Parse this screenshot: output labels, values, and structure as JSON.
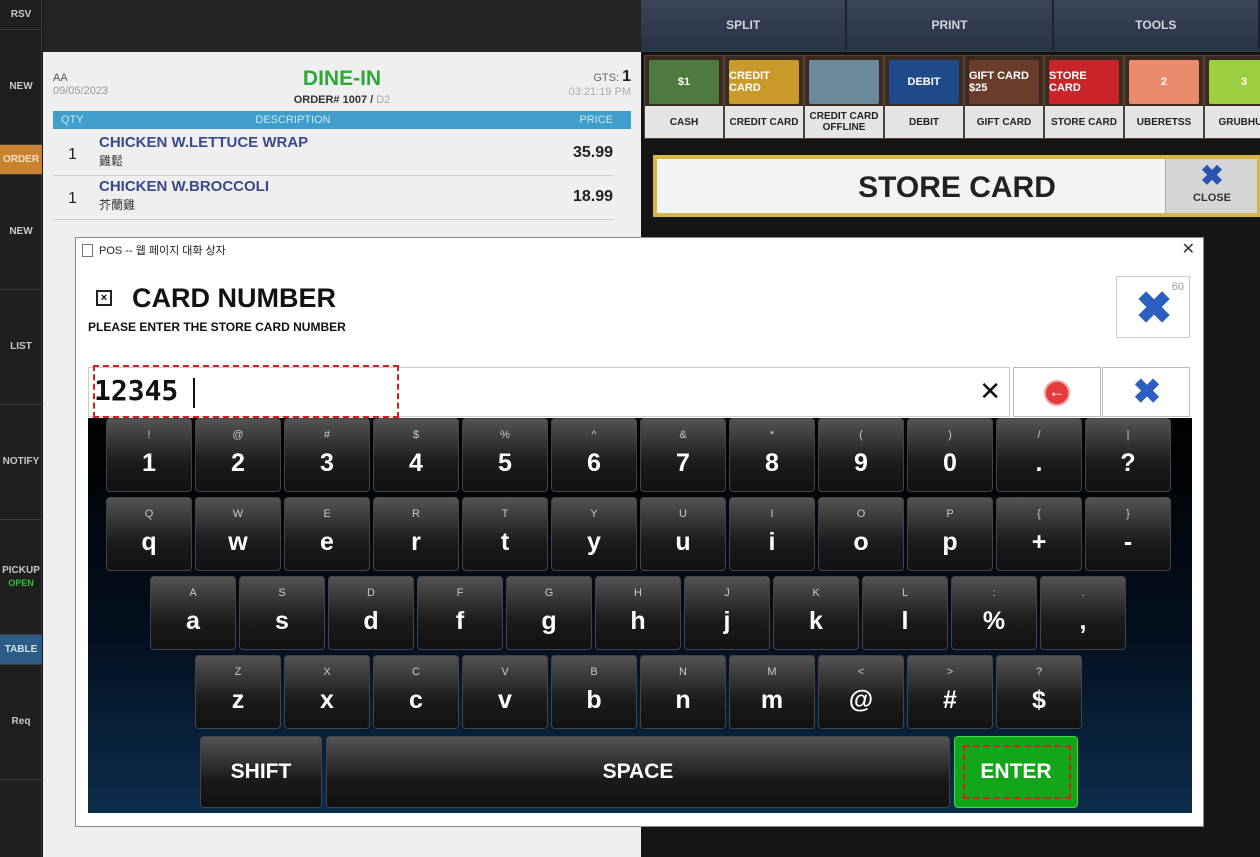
{
  "left_nav": [
    {
      "label": "RSV",
      "sub": ""
    },
    {
      "label": "NEW",
      "sub": ""
    },
    {
      "label": "ORDER",
      "sub": ""
    },
    {
      "label": "NEW",
      "sub": ""
    },
    {
      "label": "LIST",
      "sub": ""
    },
    {
      "label": "NOTIFY",
      "sub": ""
    },
    {
      "label": "PICKUP",
      "sub": "OPEN"
    },
    {
      "label": "TABLE",
      "sub": ""
    },
    {
      "label": "Req",
      "sub": ""
    }
  ],
  "top_buttons": {
    "split": "SPLIT",
    "print": "PRINT",
    "tools": "TOOLS"
  },
  "order": {
    "server": "AA",
    "date": "09/05/2023",
    "title": "DINE-IN",
    "order_label": "ORDER# 1007 /",
    "order_sub": " D2",
    "gts_label": "GTS: ",
    "gts_value": "1",
    "time": "03:21:19 PM",
    "headers": {
      "qty": "QTY",
      "desc": "DESCRIPTION",
      "price": "PRICE"
    },
    "items": [
      {
        "qty": "1",
        "name": "CHICKEN W.LETTUCE WRAP",
        "sub": "雞鬆",
        "price": "35.99"
      },
      {
        "qty": "1",
        "name": "CHICKEN W.BROCCOLI",
        "sub": "芥蘭雞",
        "price": "18.99"
      }
    ]
  },
  "payments": [
    {
      "label": "CASH",
      "img": "$1",
      "color": "#4d7a3f"
    },
    {
      "label": "CREDIT CARD",
      "img": "CREDIT CARD",
      "color": "#c89a2a"
    },
    {
      "label": "CREDIT CARD OFFLINE",
      "img": "",
      "color": "#6b8a9b"
    },
    {
      "label": "DEBIT",
      "img": "DEBIT",
      "color": "#1f4a8a"
    },
    {
      "label": "GIFT CARD",
      "img": "GIFT CARD $25",
      "color": "#6a3c2b"
    },
    {
      "label": "STORE CARD",
      "img": "STORE CARD",
      "color": "#c8242a"
    },
    {
      "label": "UBERETSS",
      "img": "2",
      "color": "#e98b6c"
    },
    {
      "label": "GRUBHUB",
      "img": "3",
      "color": "#9bcf3f"
    }
  ],
  "store_card": {
    "title": "STORE CARD",
    "close": "CLOSE"
  },
  "dialog": {
    "titlebar": "POS -- 웹 페이지 대화 상자",
    "title": "CARD NUMBER",
    "subtitle": "PLEASE ENTER THE STORE CARD NUMBER",
    "timer": "60",
    "input_value": "12345"
  },
  "keyboard": {
    "row1": [
      {
        "s": "!",
        "m": "1"
      },
      {
        "s": "@",
        "m": "2"
      },
      {
        "s": "#",
        "m": "3"
      },
      {
        "s": "$",
        "m": "4"
      },
      {
        "s": "%",
        "m": "5"
      },
      {
        "s": "^",
        "m": "6"
      },
      {
        "s": "&",
        "m": "7"
      },
      {
        "s": "*",
        "m": "8"
      },
      {
        "s": "(",
        "m": "9"
      },
      {
        "s": ")",
        "m": "0"
      },
      {
        "s": "/",
        "m": "."
      },
      {
        "s": "|",
        "m": "?"
      }
    ],
    "row2": [
      {
        "s": "Q",
        "m": "q"
      },
      {
        "s": "W",
        "m": "w"
      },
      {
        "s": "E",
        "m": "e"
      },
      {
        "s": "R",
        "m": "r"
      },
      {
        "s": "T",
        "m": "t"
      },
      {
        "s": "Y",
        "m": "y"
      },
      {
        "s": "U",
        "m": "u"
      },
      {
        "s": "I",
        "m": "i"
      },
      {
        "s": "O",
        "m": "o"
      },
      {
        "s": "P",
        "m": "p"
      },
      {
        "s": "{",
        "m": "+"
      },
      {
        "s": "}",
        "m": "-"
      }
    ],
    "row3": [
      {
        "s": "A",
        "m": "a"
      },
      {
        "s": "S",
        "m": "s"
      },
      {
        "s": "D",
        "m": "d"
      },
      {
        "s": "F",
        "m": "f"
      },
      {
        "s": "G",
        "m": "g"
      },
      {
        "s": "H",
        "m": "h"
      },
      {
        "s": "J",
        "m": "j"
      },
      {
        "s": "K",
        "m": "k"
      },
      {
        "s": "L",
        "m": "l"
      },
      {
        "s": ":",
        "m": "%"
      },
      {
        "s": ".",
        "m": ","
      }
    ],
    "row4": [
      {
        "s": "Z",
        "m": "z"
      },
      {
        "s": "X",
        "m": "x"
      },
      {
        "s": "C",
        "m": "c"
      },
      {
        "s": "V",
        "m": "v"
      },
      {
        "s": "B",
        "m": "b"
      },
      {
        "s": "N",
        "m": "n"
      },
      {
        "s": "M",
        "m": "m"
      },
      {
        "s": "<",
        "m": "@"
      },
      {
        "s": ">",
        "m": "#"
      },
      {
        "s": "?",
        "m": "$"
      }
    ],
    "shift": "SHIFT",
    "space": "SPACE",
    "enter": "ENTER"
  }
}
